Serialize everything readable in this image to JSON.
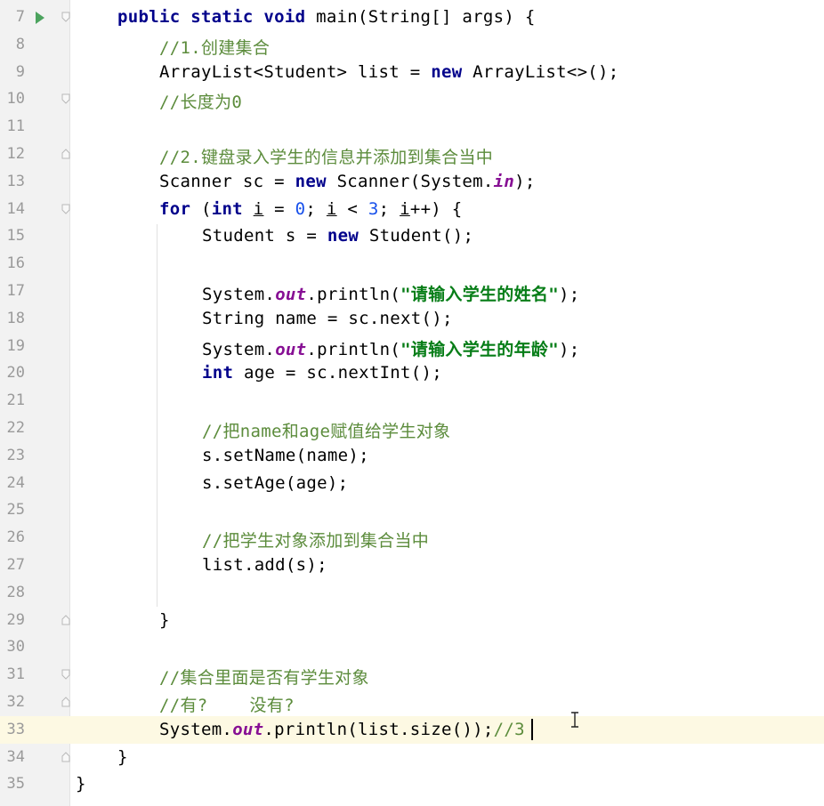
{
  "editor": {
    "current_line": 33,
    "lines": [
      {
        "num": "7",
        "indent": 1,
        "run": true,
        "fold": "open",
        "tokens": [
          [
            "kw",
            "public"
          ],
          [
            "p",
            " "
          ],
          [
            "kw",
            "static"
          ],
          [
            "p",
            " "
          ],
          [
            "kw",
            "void"
          ],
          [
            "p",
            " main(String[] args) {"
          ]
        ]
      },
      {
        "num": "8",
        "indent": 2,
        "tokens": [
          [
            "cm",
            "//1.创建集合"
          ]
        ]
      },
      {
        "num": "9",
        "indent": 2,
        "tokens": [
          [
            "p",
            "ArrayList<Student> list = "
          ],
          [
            "kw",
            "new"
          ],
          [
            "p",
            " ArrayList<>();"
          ]
        ]
      },
      {
        "num": "10",
        "indent": 2,
        "fold": "open",
        "tokens": [
          [
            "cm",
            "//长度为0"
          ]
        ]
      },
      {
        "num": "11",
        "indent": 2,
        "tokens": []
      },
      {
        "num": "12",
        "indent": 2,
        "fold": "close",
        "tokens": [
          [
            "cm",
            "//2.键盘录入学生的信息并添加到集合当中"
          ]
        ]
      },
      {
        "num": "13",
        "indent": 2,
        "tokens": [
          [
            "p",
            "Scanner sc = "
          ],
          [
            "kw",
            "new"
          ],
          [
            "p",
            " Scanner(System."
          ],
          [
            "field",
            "in"
          ],
          [
            "p",
            ");"
          ]
        ]
      },
      {
        "num": "14",
        "indent": 2,
        "fold": "open",
        "tokens": [
          [
            "kw",
            "for"
          ],
          [
            "p",
            " ("
          ],
          [
            "kw",
            "int"
          ],
          [
            "p",
            " "
          ],
          [
            "u",
            "i"
          ],
          [
            "p",
            " = "
          ],
          [
            "num",
            "0"
          ],
          [
            "p",
            "; "
          ],
          [
            "u",
            "i"
          ],
          [
            "p",
            " < "
          ],
          [
            "num",
            "3"
          ],
          [
            "p",
            "; "
          ],
          [
            "u",
            "i"
          ],
          [
            "p",
            "++) {"
          ]
        ]
      },
      {
        "num": "15",
        "indent": 3,
        "tokens": [
          [
            "p",
            "Student s = "
          ],
          [
            "kw",
            "new"
          ],
          [
            "p",
            " Student();"
          ]
        ]
      },
      {
        "num": "16",
        "indent": 3,
        "tokens": []
      },
      {
        "num": "17",
        "indent": 3,
        "tokens": [
          [
            "p",
            "System."
          ],
          [
            "field",
            "out"
          ],
          [
            "p",
            ".println("
          ],
          [
            "str",
            "\"请输入学生的姓名\""
          ],
          [
            "p",
            ");"
          ]
        ]
      },
      {
        "num": "18",
        "indent": 3,
        "tokens": [
          [
            "p",
            "String name = sc.next();"
          ]
        ]
      },
      {
        "num": "19",
        "indent": 3,
        "tokens": [
          [
            "p",
            "System."
          ],
          [
            "field",
            "out"
          ],
          [
            "p",
            ".println("
          ],
          [
            "str",
            "\"请输入学生的年龄\""
          ],
          [
            "p",
            ");"
          ]
        ]
      },
      {
        "num": "20",
        "indent": 3,
        "tokens": [
          [
            "kw",
            "int"
          ],
          [
            "p",
            " age = sc.nextInt();"
          ]
        ]
      },
      {
        "num": "21",
        "indent": 3,
        "tokens": []
      },
      {
        "num": "22",
        "indent": 3,
        "tokens": [
          [
            "cm",
            "//把name和age赋值给学生对象"
          ]
        ]
      },
      {
        "num": "23",
        "indent": 3,
        "tokens": [
          [
            "p",
            "s.setName(name);"
          ]
        ]
      },
      {
        "num": "24",
        "indent": 3,
        "tokens": [
          [
            "p",
            "s.setAge(age);"
          ]
        ]
      },
      {
        "num": "25",
        "indent": 3,
        "tokens": []
      },
      {
        "num": "26",
        "indent": 3,
        "tokens": [
          [
            "cm",
            "//把学生对象添加到集合当中"
          ]
        ]
      },
      {
        "num": "27",
        "indent": 3,
        "tokens": [
          [
            "p",
            "list.add(s);"
          ]
        ]
      },
      {
        "num": "28",
        "indent": 3,
        "tokens": []
      },
      {
        "num": "29",
        "indent": 2,
        "fold": "close",
        "tokens": [
          [
            "p",
            "}"
          ]
        ]
      },
      {
        "num": "30",
        "indent": 2,
        "tokens": []
      },
      {
        "num": "31",
        "indent": 2,
        "fold": "open",
        "tokens": [
          [
            "cm",
            "//集合里面是否有学生对象"
          ]
        ]
      },
      {
        "num": "32",
        "indent": 2,
        "fold": "close",
        "tokens": [
          [
            "cm",
            "//有?    没有?"
          ]
        ]
      },
      {
        "num": "33",
        "indent": 2,
        "tokens": [
          [
            "p",
            "System."
          ],
          [
            "field",
            "out"
          ],
          [
            "p",
            ".println(list.size());"
          ],
          [
            "cm",
            "//3"
          ]
        ]
      },
      {
        "num": "34",
        "indent": 1,
        "fold": "close",
        "tokens": [
          [
            "p",
            "}"
          ]
        ]
      },
      {
        "num": "35",
        "indent": 0,
        "tokens": [
          [
            "p",
            "}"
          ]
        ]
      }
    ]
  }
}
